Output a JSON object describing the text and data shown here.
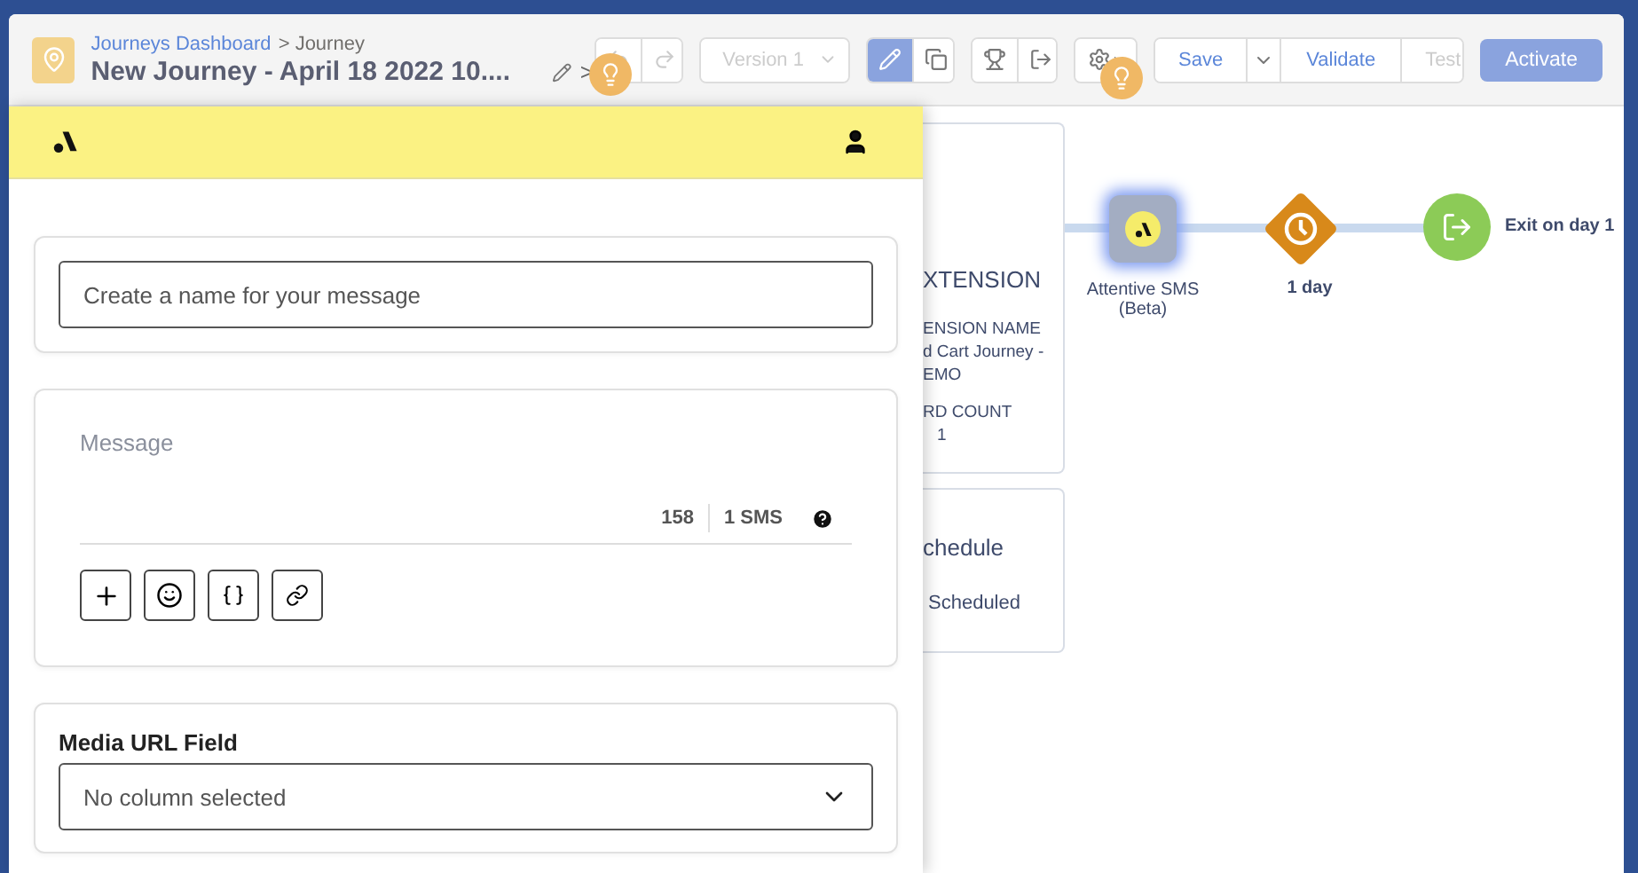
{
  "header": {
    "breadcrumb": {
      "link": "Journeys Dashboard",
      "separator": ">",
      "current": "Journey"
    },
    "title": "New Journey - April 18 2022 10....",
    "chevron": ">",
    "version": {
      "label": "Version 1",
      "disabled": true
    },
    "mode_buttons": [
      {
        "kind": "edit",
        "selected": true
      },
      {
        "kind": "copy",
        "selected": false
      }
    ],
    "actions": [
      {
        "label": "Save",
        "disabled": false
      },
      {
        "label": "Validate",
        "disabled": false
      },
      {
        "label": "Test",
        "disabled": true
      }
    ],
    "activate": "Activate"
  },
  "canvas": {
    "entry_card": {
      "title": "XTENSION",
      "fields": [
        {
          "label": "ENSION NAME",
          "lines": [
            "d Cart Journey -",
            "EMO"
          ]
        },
        {
          "label": "RD COUNT",
          "lines": [
            "1"
          ]
        }
      ]
    },
    "schedule_card": {
      "title": "chedule",
      "status": "Scheduled"
    },
    "nodes": [
      {
        "kind": "sms",
        "label": "Attentive SMS (Beta)",
        "selected": true
      },
      {
        "kind": "wait",
        "label": "1 day",
        "selected": false
      },
      {
        "kind": "exit",
        "label": "Exit on day 1",
        "selected": false
      }
    ]
  },
  "panel": {
    "name_field": {
      "placeholder": "Create a name for your message"
    },
    "message": {
      "placeholder": "Message",
      "char_count": "158",
      "sms_count": "1 SMS",
      "tools": [
        {
          "kind": "add"
        },
        {
          "kind": "emoji"
        },
        {
          "kind": "variable"
        },
        {
          "kind": "link"
        }
      ]
    },
    "media": {
      "label": "Media URL Field",
      "value": "No column selected"
    }
  }
}
